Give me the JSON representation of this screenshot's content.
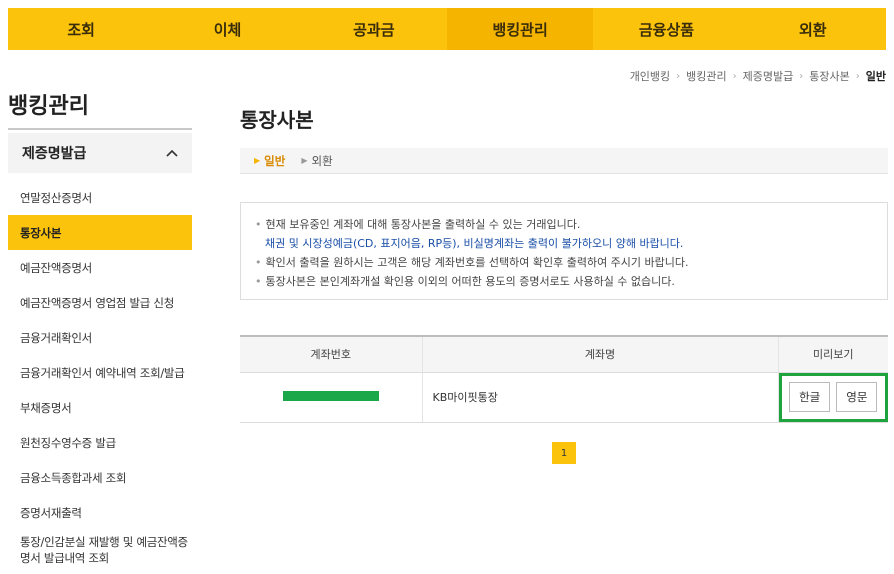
{
  "topnav": [
    {
      "label": "조회"
    },
    {
      "label": "이체"
    },
    {
      "label": "공과금"
    },
    {
      "label": "뱅킹관리"
    },
    {
      "label": "금융상품"
    },
    {
      "label": "외환"
    }
  ],
  "breadcrumb": [
    "개인뱅킹",
    "뱅킹관리",
    "제증명발급",
    "통장사본",
    "일반"
  ],
  "sidebar": {
    "title": "뱅킹관리",
    "group": "제증명발급",
    "items": [
      {
        "label": "연말정산증명서"
      },
      {
        "label": "통장사본"
      },
      {
        "label": "예금잔액증명서"
      },
      {
        "label": "예금잔액증명서 영업점 발급 신청"
      },
      {
        "label": "금융거래확인서"
      },
      {
        "label": "금융거래확인서 예약내역 조회/발급"
      },
      {
        "label": "부채증명서"
      },
      {
        "label": "원천징수영수증 발급"
      },
      {
        "label": "금융소득종합과세 조회"
      },
      {
        "label": "증명서재출력"
      },
      {
        "label": "통장/인감분실 재발행 및 예금잔액증명서 발급내역 조회"
      }
    ]
  },
  "main": {
    "title": "통장사본",
    "tabs": [
      {
        "label": "일반"
      },
      {
        "label": "외환"
      }
    ],
    "notice": {
      "line1": "현재 보유중인 계좌에 대해 통장사본을 출력하실 수 있는 거래입니다.",
      "line1_note": "채권 및 시장성예금(CD, 표지어음, RP등), 비실명계좌는 출력이 불가하오니 양해 바랍니다.",
      "line2": "확인서 출력을 원하시는 고객은 해당 계좌번호를 선택하여 확인후 출력하여 주시기 바랍니다.",
      "line3": "통장사본은 본인계좌개설 확인용 이외의 어떠한 용도의 증명서로도 사용하실 수 없습니다."
    },
    "table": {
      "headers": [
        "계좌번호",
        "계좌명",
        "미리보기"
      ],
      "rows": [
        {
          "account_name": "KB마이핏통장",
          "btn_korean": "한글",
          "btn_english": "영문"
        }
      ]
    },
    "pager": {
      "current": "1"
    }
  },
  "colors": {
    "brand_yellow": "#fcc30d",
    "highlight_green": "#1fa33d"
  }
}
